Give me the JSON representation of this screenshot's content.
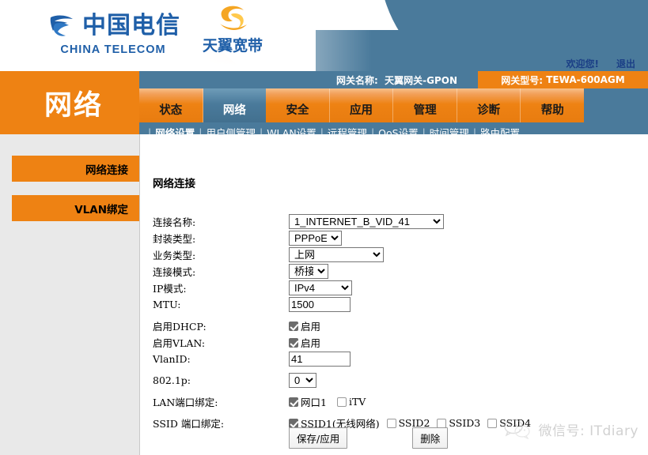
{
  "banner": {
    "brand_cn": "中国电信",
    "brand_en": "CHINA TELECOM",
    "subbrand": "天翼宽带",
    "welcome": "欢迎您!",
    "logout": "退出"
  },
  "infobar": {
    "gateway_name_label": "网关名称:",
    "gateway_name_value": "天翼网关-GPON",
    "gateway_model_label": "网关型号:",
    "gateway_model_value": "TEWA-600AGM"
  },
  "sidebar": {
    "title": "网络",
    "items": [
      {
        "label": "网络连接"
      },
      {
        "label": "VLAN绑定"
      }
    ]
  },
  "tabs": [
    {
      "label": "状态",
      "active": false
    },
    {
      "label": "网络",
      "active": true
    },
    {
      "label": "安全",
      "active": false
    },
    {
      "label": "应用",
      "active": false
    },
    {
      "label": "管理",
      "active": false
    },
    {
      "label": "诊断",
      "active": false
    },
    {
      "label": "帮助",
      "active": false
    }
  ],
  "subnav": [
    {
      "label": "网络设置",
      "active": true
    },
    {
      "label": "用户侧管理",
      "active": false
    },
    {
      "label": "WLAN设置",
      "active": false
    },
    {
      "label": "远程管理",
      "active": false
    },
    {
      "label": "QoS设置",
      "active": false
    },
    {
      "label": "时间管理",
      "active": false
    },
    {
      "label": "路由配置",
      "active": false
    }
  ],
  "content": {
    "title": "网络连接",
    "fields": {
      "conn_name_label": "连接名称:",
      "conn_name_value": "1_INTERNET_B_VID_41",
      "encap_label": "封装类型:",
      "encap_value": "PPPoE",
      "service_label": "业务类型:",
      "service_value": "上网",
      "conn_mode_label": "连接模式:",
      "conn_mode_value": "桥接",
      "ip_mode_label": "IP模式:",
      "ip_mode_value": "IPv4",
      "mtu_label": "MTU:",
      "mtu_value": "1500",
      "dhcp_label": "启用DHCP:",
      "dhcp_cb_label": "启用",
      "vlan_label": "启用VLAN:",
      "vlan_cb_label": "启用",
      "vlanid_label": "VlanID:",
      "vlanid_value": "41",
      "p8021_label": "802.1p:",
      "p8021_value": "0",
      "lan_bind_label": "LAN端口绑定:",
      "lan_port1_label": "网口1",
      "lan_itv_label": "iTV",
      "ssid_bind_label": "SSID 端口绑定:",
      "ssid1_label": "SSID1(无线网络)",
      "ssid2_label": "SSID2",
      "ssid3_label": "SSID3",
      "ssid4_label": "SSID4"
    },
    "buttons": {
      "save": "保存/应用",
      "delete": "删除"
    }
  },
  "watermark": {
    "text": "微信号: ITdiary"
  },
  "colors": {
    "orange": "#ee8213",
    "steel_blue": "#4a7a9b",
    "brand_blue": "#1f5fa8",
    "sidebar_bg": "#e9e9e9"
  }
}
